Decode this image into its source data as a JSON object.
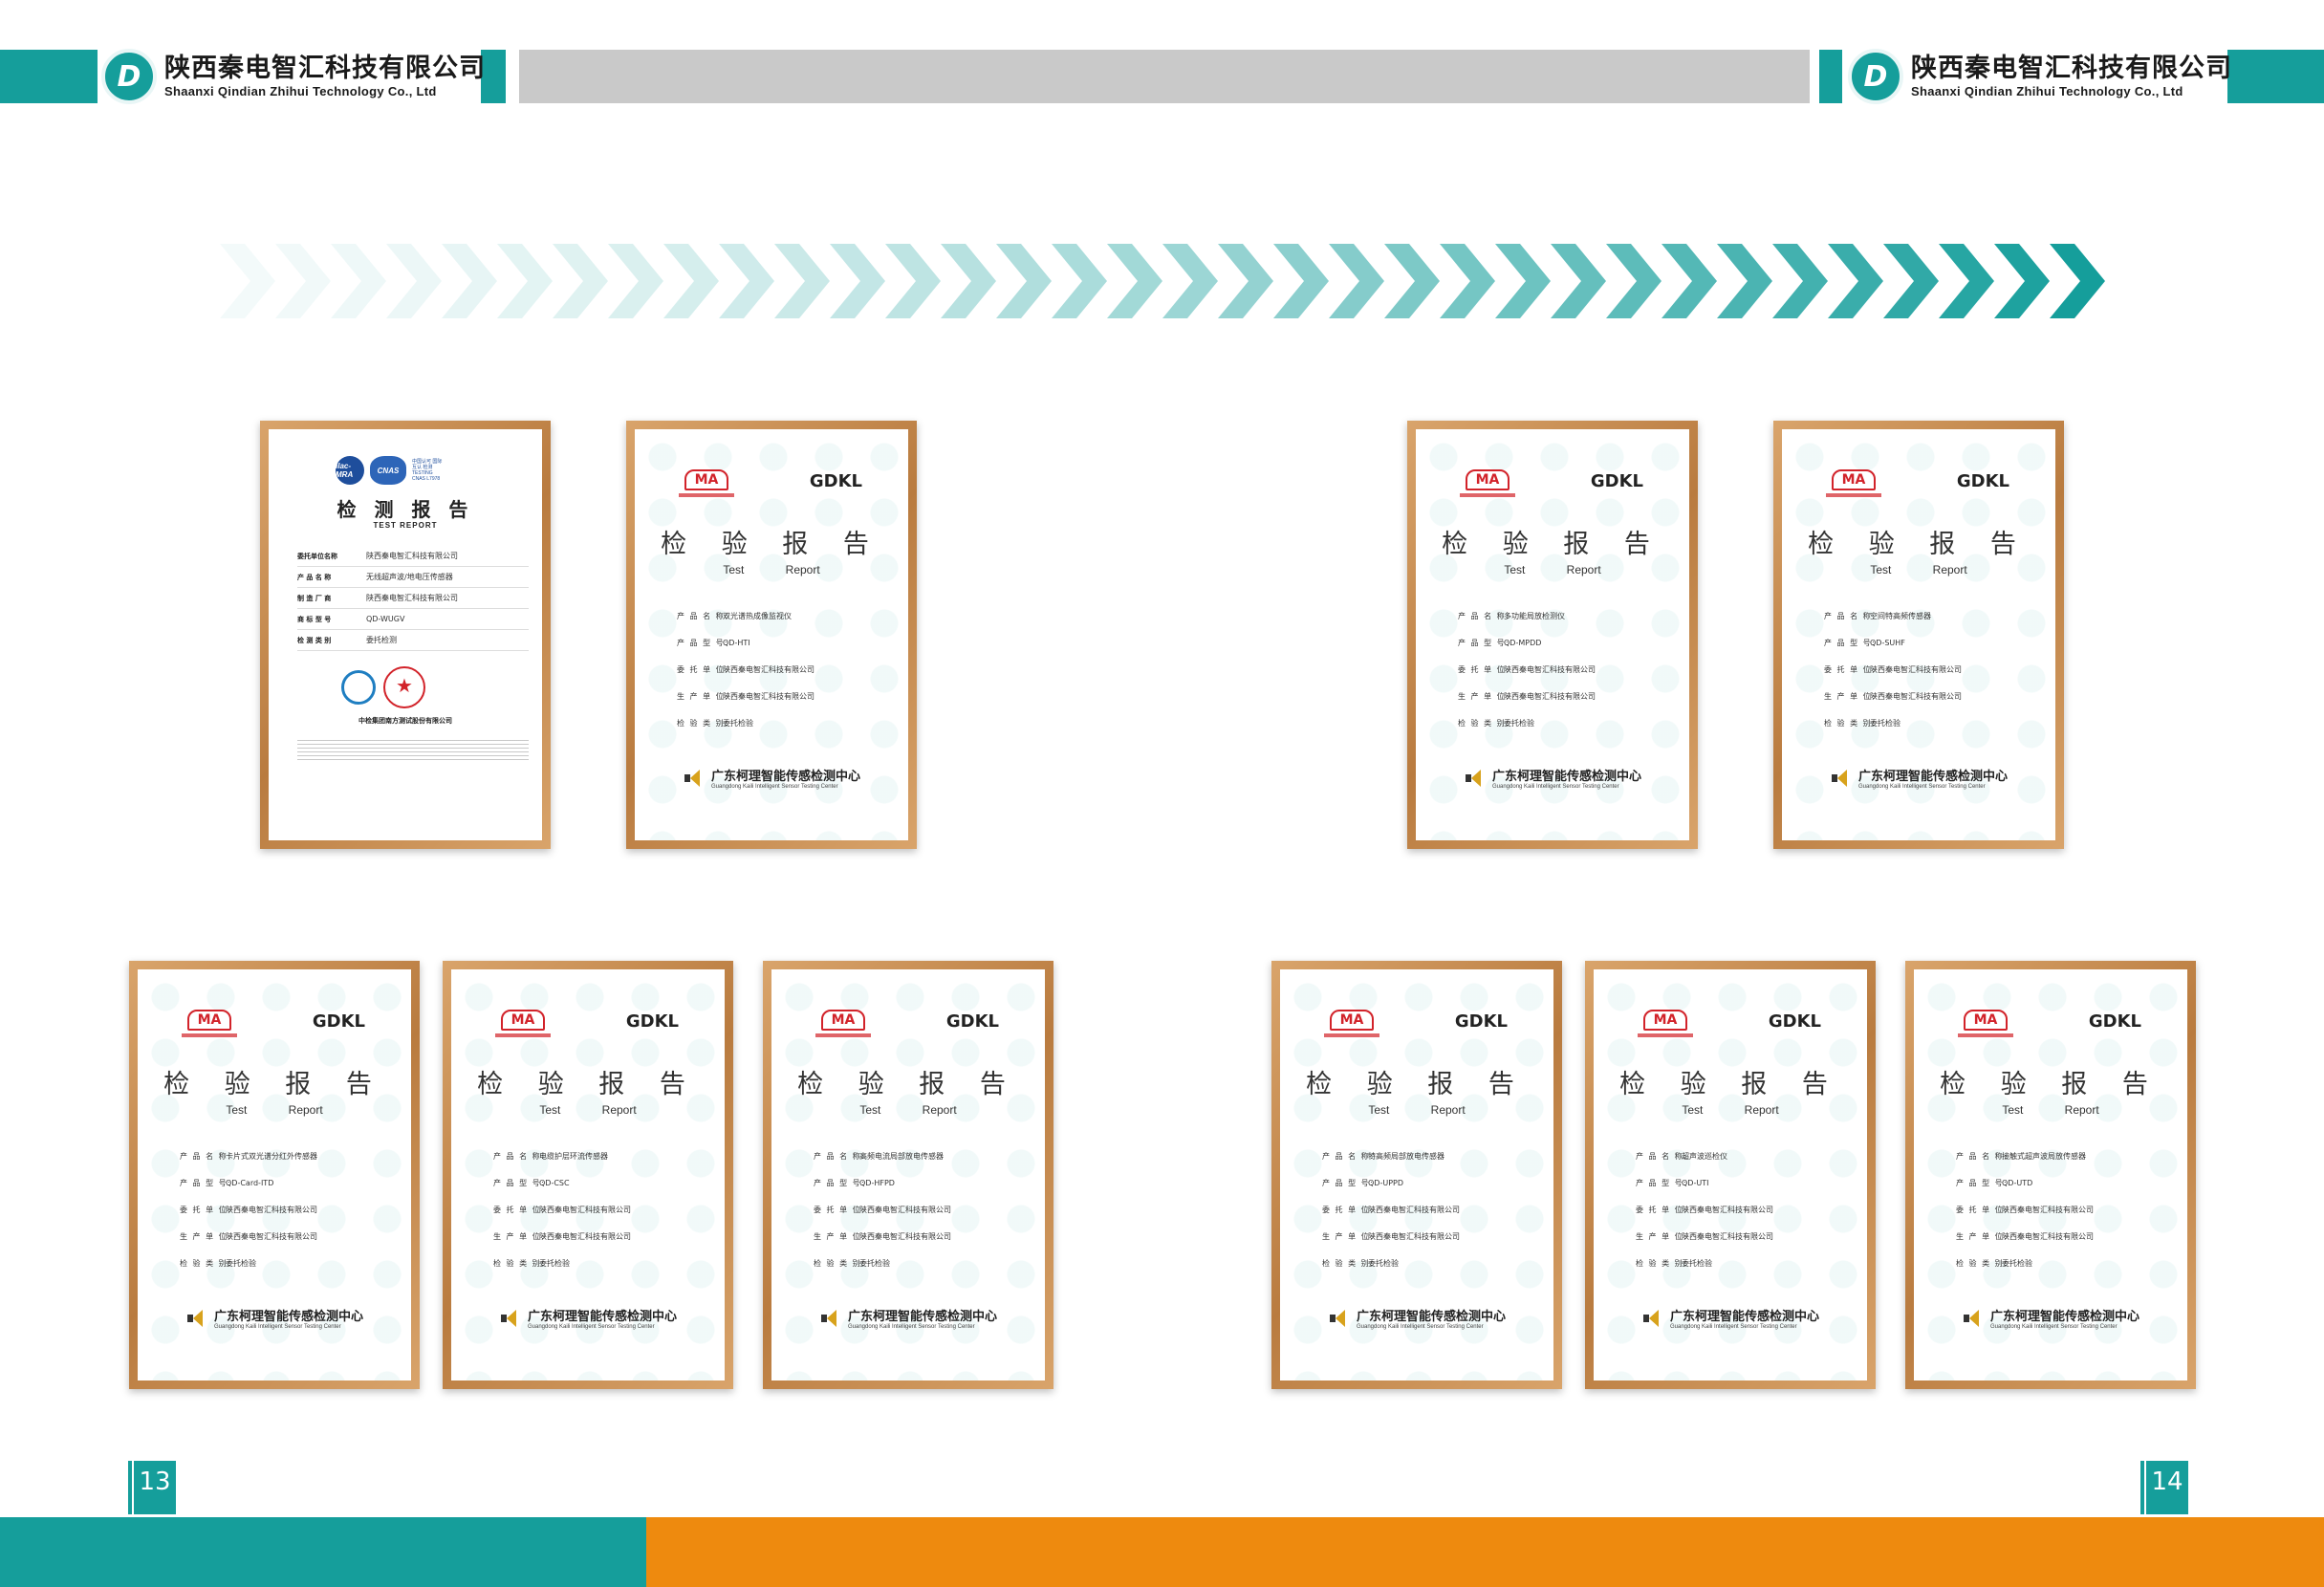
{
  "company": {
    "name_cn": "陕西秦电智汇科技有限公司",
    "name_en": "Shaanxi Qindian Zhihui Technology Co., Ltd",
    "logo_icon": "qindian-logo-icon"
  },
  "colors": {
    "teal": "#159e9b",
    "orange": "#ee8a0e",
    "gray": "#c9c9c9",
    "frame": "#c98f55"
  },
  "cnas_cert": {
    "badge1": "ilac-MRA",
    "badge2": "CNAS",
    "badge_note": "中国认可 国际互认 检测 TESTING CNAS L7978",
    "title": "检 测 报 告",
    "subtitle": "TEST  REPORT",
    "rows": [
      {
        "k": "委托单位名称",
        "v": "陕西秦电智汇科技有限公司"
      },
      {
        "k": "产 品 名 称",
        "v": "无线超声波/地电压传感器"
      },
      {
        "k": "制 造 厂 商",
        "v": "陕西秦电智汇科技有限公司"
      },
      {
        "k": "商 标 型 号",
        "v": "QD-WUGV"
      },
      {
        "k": "检 测 类 别",
        "v": "委托检测"
      }
    ],
    "org": "中检集团南方测试股份有限公司"
  },
  "report_common": {
    "mark": "MA",
    "code": "GDKL",
    "title_cn": "检 验 报 告",
    "title_en": "Test Report",
    "labels": [
      "产 品 名 称:",
      "产 品 型 号:",
      "委 托 单 位:",
      "生 产 单 位:",
      "检 验 类 别:"
    ],
    "lab_cn": "广东柯理智能传感检测中心",
    "lab_en": "Guangdong Kaili Intelligent Sensor Testing Center"
  },
  "reports": [
    {
      "product": "双光谱热成像监视仪",
      "model": "QD-HTI",
      "client": "陕西秦电智汇科技有限公司",
      "maker": "陕西秦电智汇科技有限公司",
      "type": "委托检验"
    },
    {
      "product": "多功能局放检测仪",
      "model": "QD-MPDD",
      "client": "陕西秦电智汇科技有限公司",
      "maker": "陕西秦电智汇科技有限公司",
      "type": "委托检验"
    },
    {
      "product": "空间特高频传感器",
      "model": "QD-SUHF",
      "client": "陕西秦电智汇科技有限公司",
      "maker": "陕西秦电智汇科技有限公司",
      "type": "委托检验"
    },
    {
      "product": "卡片式双光谱分红外传感器",
      "model": "QD-Card-ITD",
      "client": "陕西秦电智汇科技有限公司",
      "maker": "陕西秦电智汇科技有限公司",
      "type": "委托检验"
    },
    {
      "product": "电缆护层环流传感器",
      "model": "QD-CSC",
      "client": "陕西秦电智汇科技有限公司",
      "maker": "陕西秦电智汇科技有限公司",
      "type": "委托检验"
    },
    {
      "product": "高频电流局部放电传感器",
      "model": "QD-HFPD",
      "client": "陕西秦电智汇科技有限公司",
      "maker": "陕西秦电智汇科技有限公司",
      "type": "委托检验"
    },
    {
      "product": "特高频局部放电传感器",
      "model": "QD-UPPD",
      "client": "陕西秦电智汇科技有限公司",
      "maker": "陕西秦电智汇科技有限公司",
      "type": "委托检验"
    },
    {
      "product": "超声波巡检仪",
      "model": "QD-UTI",
      "client": "陕西秦电智汇科技有限公司",
      "maker": "陕西秦电智汇科技有限公司",
      "type": "委托检验"
    },
    {
      "product": "接触式超声波局放传感器",
      "model": "QD-UTD",
      "client": "陕西秦电智汇科技有限公司",
      "maker": "陕西秦电智汇科技有限公司",
      "type": "委托检验"
    }
  ],
  "pages": {
    "left": "13",
    "right": "14"
  }
}
